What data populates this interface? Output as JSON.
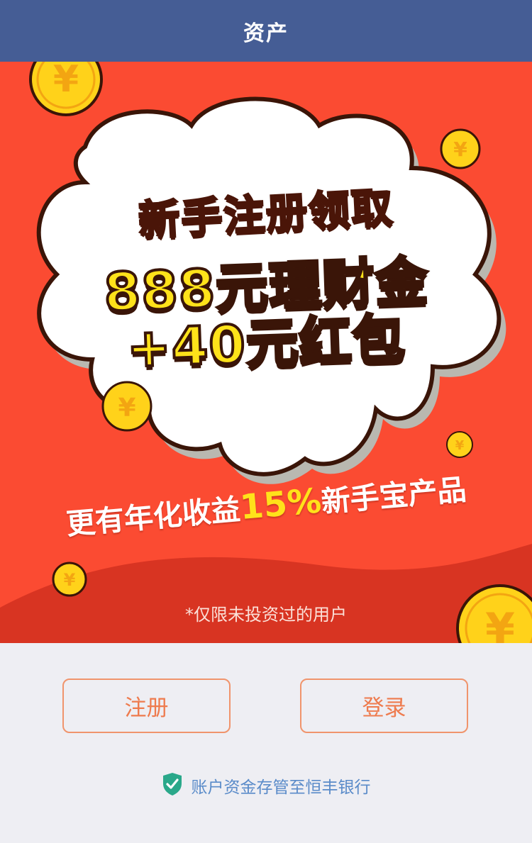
{
  "header": {
    "title": "资产"
  },
  "banner": {
    "line1": "新手注册领取",
    "line2": "888元理财金",
    "line3": "+40元红包",
    "subline_prefix": "更有年化收益",
    "subline_highlight": "15%",
    "subline_suffix": "新手宝产品",
    "note": "*仅限未投资过的用户",
    "coin_symbol": "¥",
    "colors": {
      "background": "#fb4b32",
      "wave": "#d83422",
      "coin": "#ffd21a",
      "title_yellow": "#ffe21a"
    }
  },
  "actions": {
    "register_label": "注册",
    "login_label": "登录"
  },
  "footer": {
    "text": "账户资金存管至恒丰银行",
    "icon": "shield-check-icon",
    "color": "#5a8bc9"
  }
}
